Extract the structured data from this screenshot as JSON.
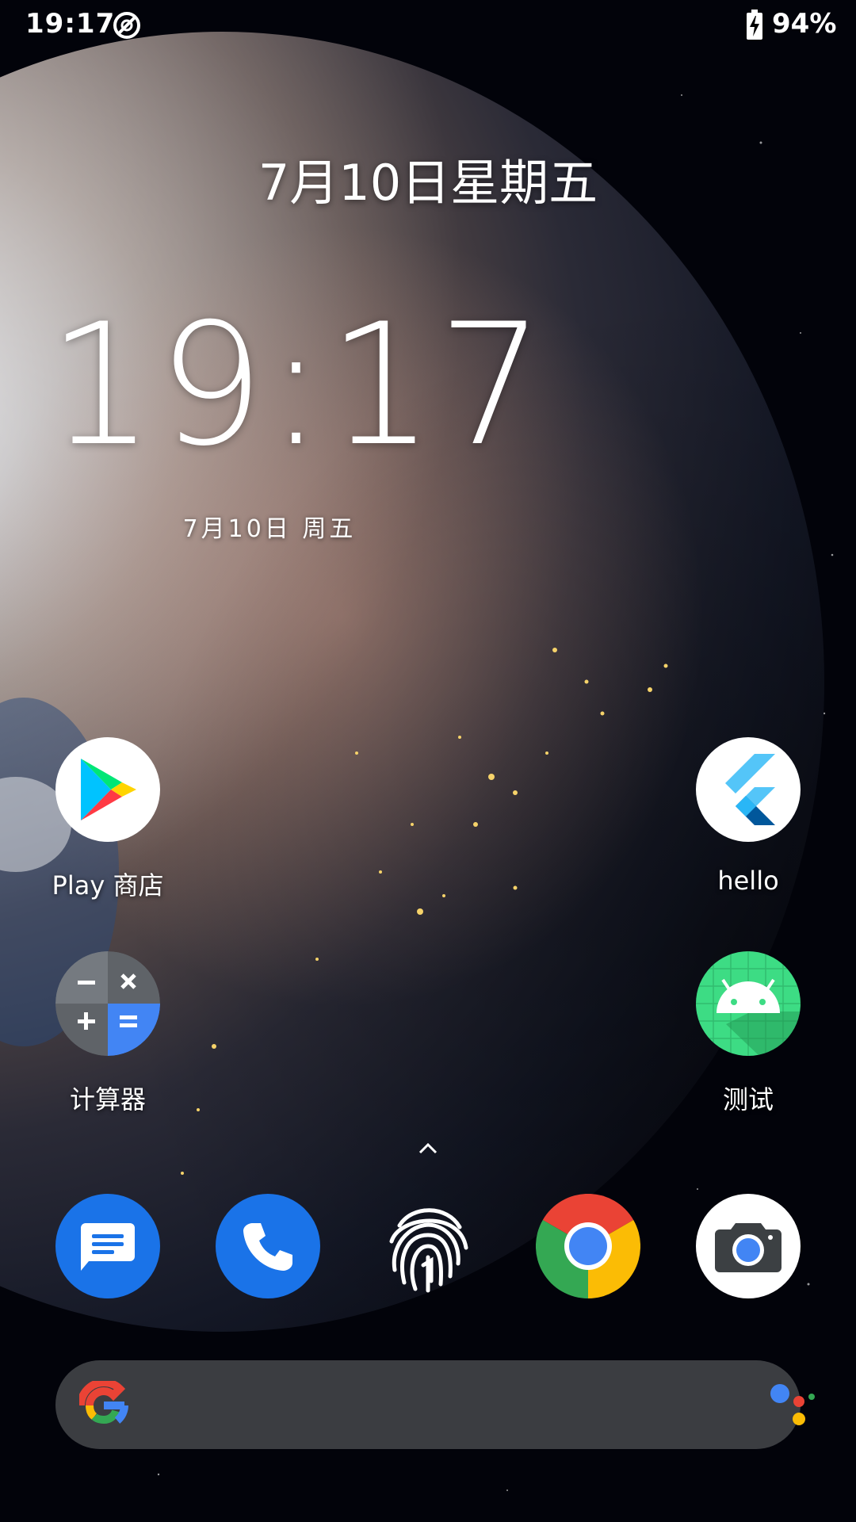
{
  "status_bar": {
    "time": "19:17",
    "battery": "94%"
  },
  "clock_widget": {
    "date_top": "7月10日星期五",
    "time": "19:17",
    "date_small": "7月10日 周五"
  },
  "apps": [
    {
      "label": "Play 商店",
      "icon": "play-store-icon"
    },
    {
      "label": "hello",
      "icon": "flutter-icon"
    },
    {
      "label": "计算器",
      "icon": "calculator-icon"
    },
    {
      "label": "测试",
      "icon": "android-icon"
    }
  ],
  "dock": [
    {
      "name": "messages",
      "icon": "messages-icon"
    },
    {
      "name": "phone",
      "icon": "phone-icon"
    },
    {
      "name": "fingerprint",
      "icon": "fingerprint-icon"
    },
    {
      "name": "chrome",
      "icon": "chrome-icon"
    },
    {
      "name": "camera",
      "icon": "camera-icon"
    }
  ],
  "search": {
    "placeholder": ""
  },
  "colors": {
    "google_blue": "#4285F4",
    "google_red": "#EA4335",
    "google_yellow": "#FBBC05",
    "google_green": "#34A853",
    "dock_blue": "#1A73E8"
  }
}
